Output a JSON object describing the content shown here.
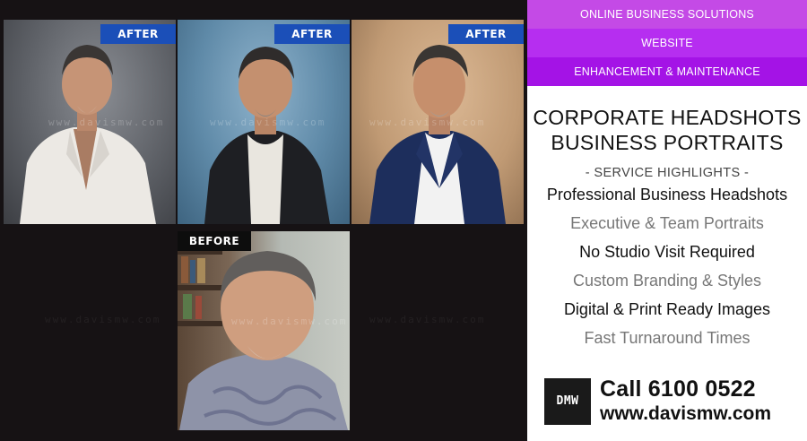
{
  "photos": {
    "after_label": "AFTER",
    "before_label": "BEFORE",
    "watermark": "www.davismw.com"
  },
  "sidebar": {
    "bands": [
      "ONLINE BUSINESS SOLUTIONS",
      "WEBSITE",
      "ENHANCEMENT & MAINTENANCE"
    ],
    "title_line1": "CORPORATE HEADSHOTS",
    "title_line2": "BUSINESS PORTRAITS",
    "subtitle": "- SERVICE HIGHLIGHTS -",
    "services": [
      "Professional Business Headshots",
      "Executive & Team Portraits",
      "No Studio Visit Required",
      "Custom Branding & Styles",
      "Digital & Print Ready Images",
      "Fast Turnaround Times"
    ],
    "logo": "DMW",
    "phone": "Call 6100 0522",
    "website": "www.davismw.com"
  },
  "colors": {
    "panel_bg": "#161214",
    "badge_blue": "#1b4fb8",
    "band_purple_1": "#c44ae6",
    "band_purple_2": "#b62ef0",
    "band_purple_3": "#a413e6"
  }
}
